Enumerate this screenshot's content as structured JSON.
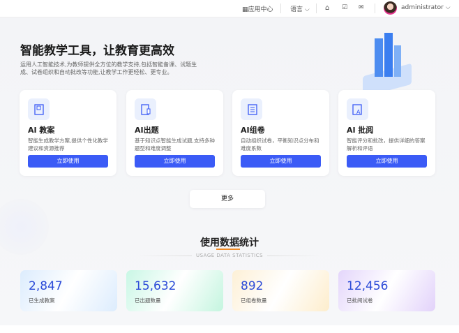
{
  "header": {
    "app_center": "应用中心",
    "language": "语言",
    "username": "administrator"
  },
  "hero": {
    "title": "智能教学工具，让教育更高效",
    "description": "运用人工智能技术,为教师提供全方位的教学支持,包括智能备课、试题生成、试卷组织和自动批改等功能,让教学工作更轻松、更专业。"
  },
  "tools": [
    {
      "title": "AI 教案",
      "description": "智能生成教学方案,提供个性化教学建议和资源推荐",
      "button": "立即使用",
      "icon": "book-icon"
    },
    {
      "title": "AI出题",
      "description": "基于知识点智能生成试题,支持多种题型和难度调整",
      "button": "立即使用",
      "icon": "question-edit-icon"
    },
    {
      "title": "AI组卷",
      "description": "自动组织试卷，平衡知识点分布和难度系数",
      "button": "立即使用",
      "icon": "paper-icon"
    },
    {
      "title": "AI 批阅",
      "description": "智能评分和批改，提供详细的答案解析和评语",
      "button": "立即使用",
      "icon": "grading-icon"
    }
  ],
  "more_label": "更多",
  "stats": {
    "title": "使用数据统计",
    "subtitle": "USAGE DATA STATISTICS",
    "items": [
      {
        "value": "2,847",
        "label": "已生成教案"
      },
      {
        "value": "15,632",
        "label": "已出题数量"
      },
      {
        "value": "892",
        "label": "已组卷数量"
      },
      {
        "value": "12,456",
        "label": "已批阅试卷"
      }
    ]
  },
  "colors": {
    "accent": "#3b5bf6",
    "underline": "#f08a24"
  }
}
